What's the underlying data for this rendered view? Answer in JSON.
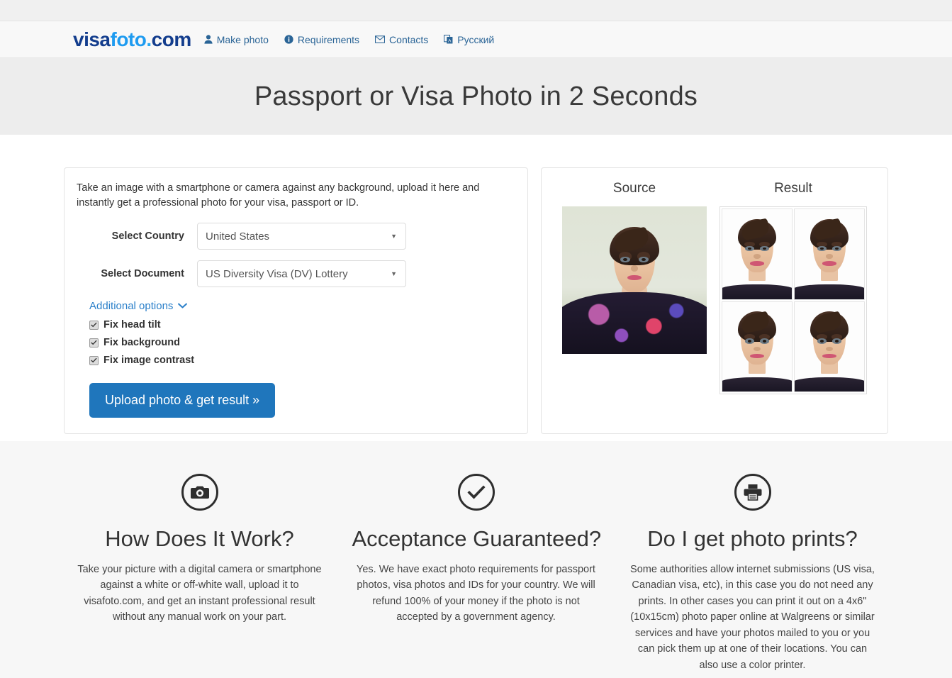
{
  "brand": {
    "logo_part1": "visa",
    "logo_part2": "foto",
    "logo_part3": ".",
    "logo_part4": "com",
    "colors": {
      "dark_blue": "#133d8d",
      "light_blue": "#1e9bf0",
      "button_blue": "#1f76bc",
      "link_blue": "#2a6496"
    }
  },
  "nav": {
    "items": [
      {
        "label": "Make photo",
        "icon": "user-icon"
      },
      {
        "label": "Requirements",
        "icon": "info-circle-icon"
      },
      {
        "label": "Contacts",
        "icon": "envelope-icon"
      },
      {
        "label": "Русский",
        "icon": "language-flag-icon"
      }
    ]
  },
  "hero": {
    "title": "Passport or Visa Photo in 2 Seconds"
  },
  "form": {
    "intro": "Take an image with a smartphone or camera against any background, upload it here and instantly get a professional photo for your visa, passport or ID.",
    "country_label": "Select Country",
    "country_value": "United States",
    "document_label": "Select Document",
    "document_value": "US Diversity Visa (DV) Lottery",
    "additional_options_label": "Additional options",
    "options": [
      {
        "label": "Fix head tilt",
        "checked": true
      },
      {
        "label": "Fix background",
        "checked": true
      },
      {
        "label": "Fix image contrast",
        "checked": true
      }
    ],
    "upload_button": "Upload photo & get result »"
  },
  "preview": {
    "source_title": "Source",
    "result_title": "Result"
  },
  "features": [
    {
      "icon": "camera-icon",
      "title": "How Does It Work?",
      "text": "Take your picture with a digital camera or smartphone against a white or off-white wall, upload it to visafoto.com, and get an instant professional result without any manual work on your part."
    },
    {
      "icon": "check-circle-icon",
      "title": "Acceptance Guaranteed?",
      "text": "Yes. We have exact photo requirements for passport photos, visa photos and IDs for your country. We will refund 100% of your money if the photo is not accepted by a government agency."
    },
    {
      "icon": "printer-icon",
      "title": "Do I get photo prints?",
      "text": "Some authorities allow internet submissions (US visa, Canadian visa, etc), in this case you do not need any prints. In other cases you can print it out on a 4x6\" (10x15cm) photo paper online at Walgreens or similar services and have your photos mailed to you or you can pick them up at one of their locations. You can also use a color printer."
    }
  ]
}
